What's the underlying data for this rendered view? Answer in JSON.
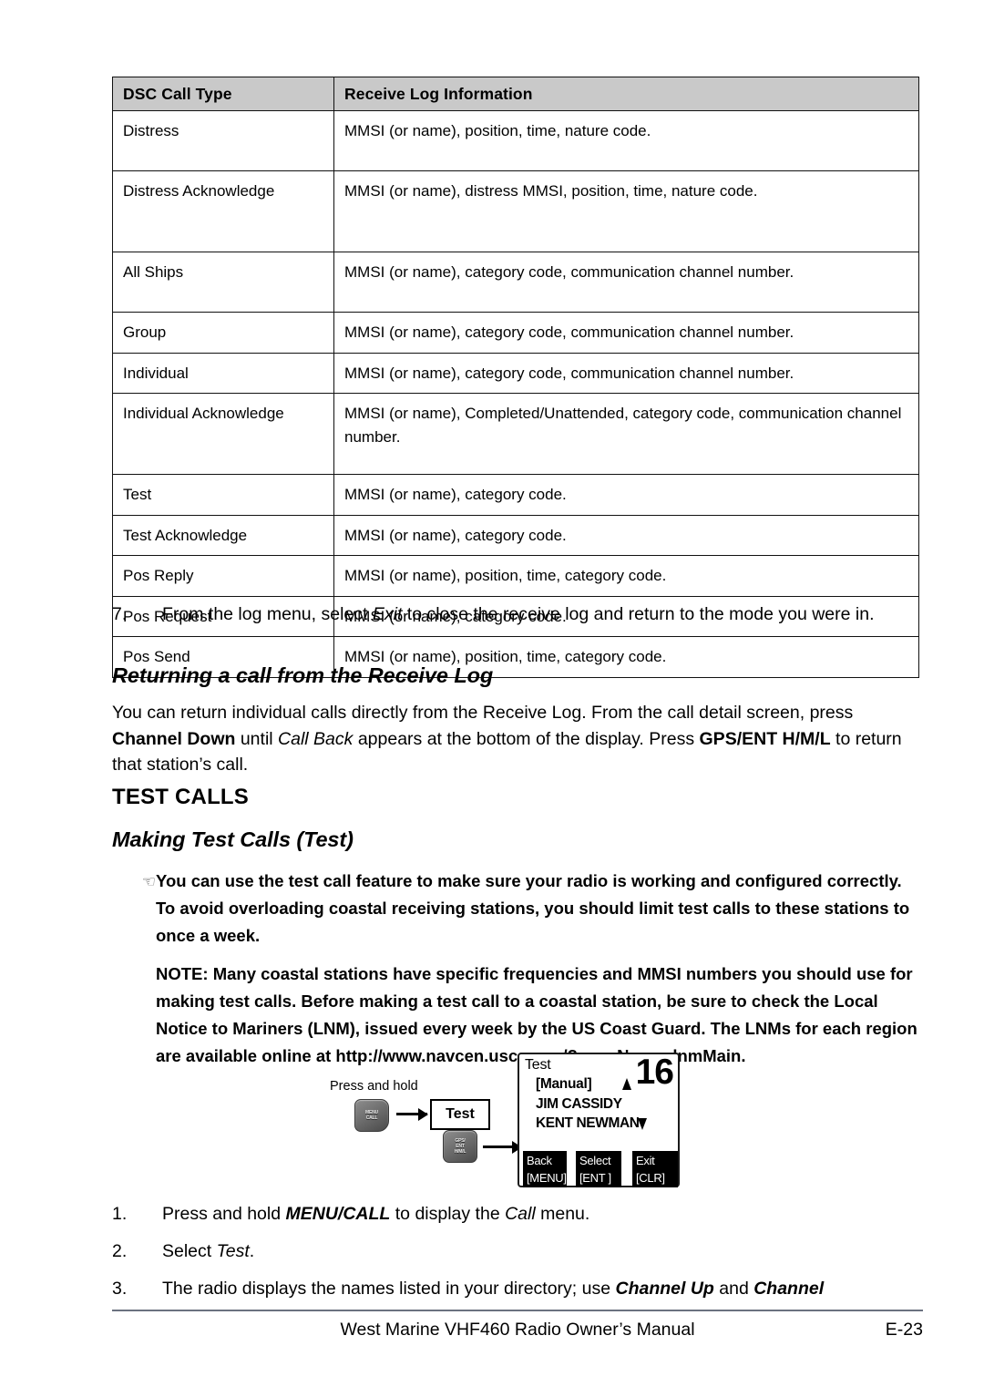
{
  "table": {
    "headers": [
      "DSC Call Type",
      "Receive Log Information"
    ],
    "rows": [
      {
        "type": "Distress",
        "info": "MMSI (or name), position, time, nature code."
      },
      {
        "type": "Distress Acknowledge",
        "info": "MMSI (or name), distress MMSI, position, time, nature code."
      },
      {
        "type": "All Ships",
        "info": "MMSI (or name), category code, communication channel number."
      },
      {
        "type": "Group",
        "info": "MMSI (or name), category code, communication channel number."
      },
      {
        "type": "Individual",
        "info": "MMSI (or name), category code, communication channel number."
      },
      {
        "type": "Individual Acknowledge",
        "info": "MMSI (or name), Completed/Unattended, category code, communication channel number."
      },
      {
        "type": "Test",
        "info": "MMSI (or name), category code."
      },
      {
        "type": "Test Acknowledge",
        "info": "MMSI (or name),  category code."
      },
      {
        "type": "Pos Reply",
        "info": "MMSI (or name), position, time, category code."
      },
      {
        "type": "Pos Request",
        "info": "MMSI (or name), category code."
      },
      {
        "type": "Pos Send",
        "info": "MMSI (or name), position, time, category code."
      }
    ]
  },
  "step7": {
    "number": "7.",
    "part1": "From the log menu, select ",
    "emph1": "Exit",
    "part2": " to close the receive log and return to the mode you were in."
  },
  "returning": {
    "heading": "Returning a call from the Receive Log",
    "p1": "You can return individual calls directly from the Receive Log. From the call detail screen, press ",
    "b1": "Channel Down",
    "p2": " until ",
    "i1": "Call Back",
    "p3": " appears at the bottom of the display. Press ",
    "b2": "GPS/ENT H/M/L",
    "p4": " to return that station’s call."
  },
  "test_calls": {
    "section_heading": "TEST CALLS",
    "sub_heading": "Making Test Calls (Test)",
    "note_icon": "☞",
    "note_p1": "You can use the test call feature to make sure your radio is working and configured correctly. To avoid overloading coastal receiving stations, you should limit test calls to these stations to once a week.",
    "note_p2": "NOTE: Many coastal stations have specific frequencies and MMSI numbers you should use for making test calls. Before making a test call to a coastal station, be sure to check the Local Notice to Mariners (LNM), issued every week by the US Coast Guard. The LNMs for each region are available online at http://www.navcen.uscg.gov/?pageName=lnmMain."
  },
  "figure": {
    "press_and_hold": "Press and hold",
    "menu_key_label": "MENU\nCALL",
    "gps_key_label": "GPS/\nENT\nH/M/L",
    "test_box": "Test",
    "lcd": {
      "title": "Test",
      "manual": "[Manual]",
      "name1": "JIM CASSIDY",
      "name2": "KENT NEWMAN",
      "channel": "16",
      "softkeys": [
        {
          "line1": "Back",
          "line2": "[MENU]"
        },
        {
          "line1": "Select",
          "line2": "[ENT ]"
        },
        {
          "line1": "Exit",
          "line2": "[CLR]"
        }
      ]
    }
  },
  "steps": [
    {
      "number": "1.",
      "part1": "Press and hold ",
      "b1": "MENU/CALL",
      "part2": " to display the ",
      "i1": "Call",
      "part3": " menu."
    },
    {
      "number": "2.",
      "part1": "Select ",
      "i1": "Test",
      "part2": "."
    },
    {
      "number": "3.",
      "part1": "The radio displays the names listed in your directory; use ",
      "b1": "Channel Up",
      "part2": " and ",
      "b2": "Channel",
      "part3": ""
    }
  ],
  "footer": {
    "title": "West Marine VHF460 Radio Owner’s Manual",
    "page": "E-23"
  }
}
